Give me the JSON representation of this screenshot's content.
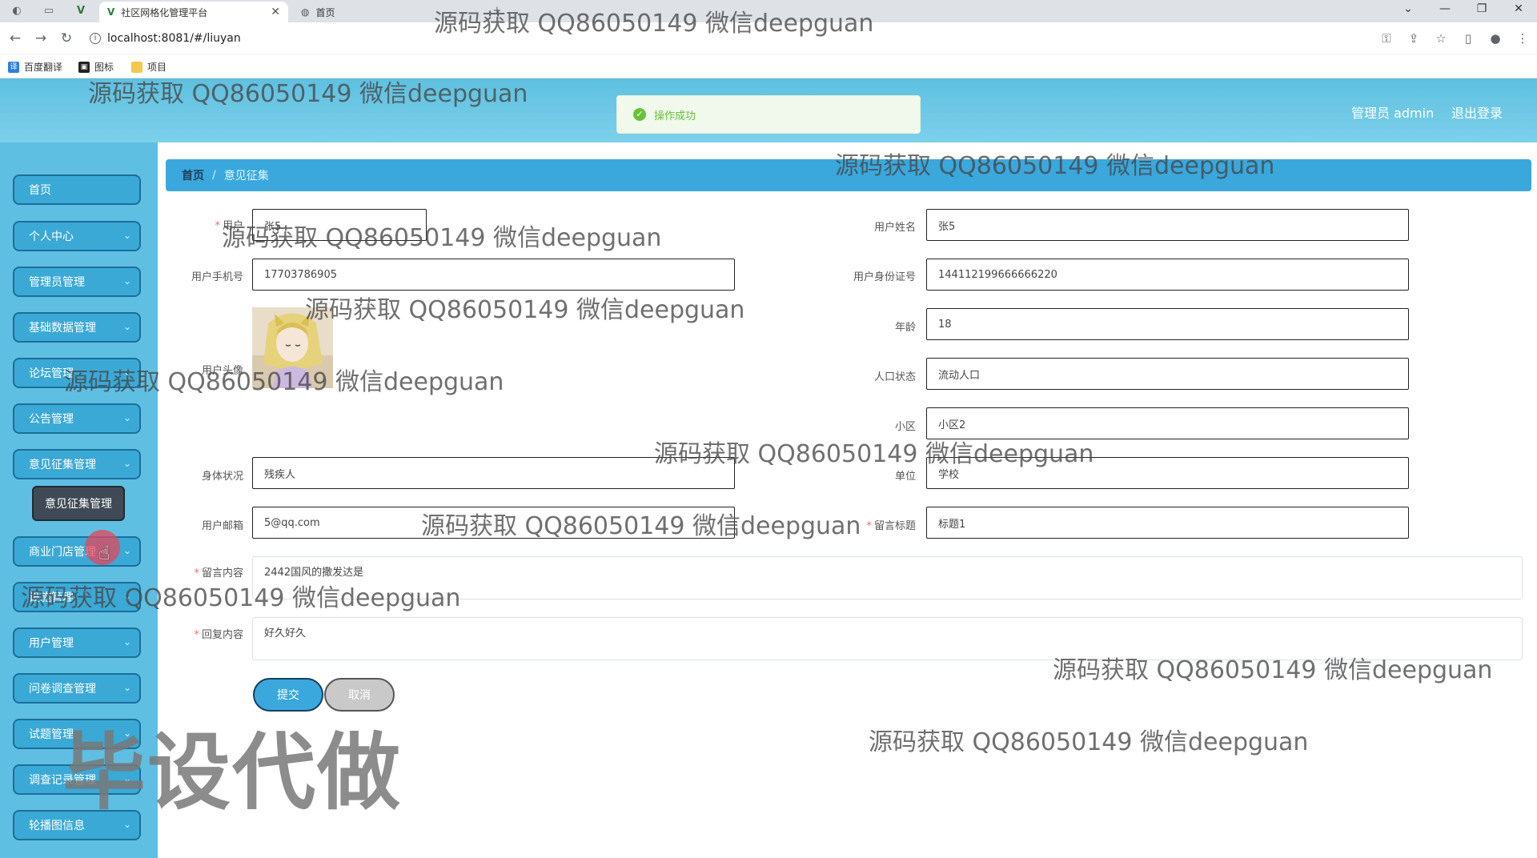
{
  "browser": {
    "tabs": [
      {
        "title": "社区网格化管理平台",
        "active": true
      },
      {
        "title": "首页",
        "active": false
      }
    ],
    "url": "localhost:8081/#/liuyan",
    "bookmarks": [
      "百度翻译",
      "图标",
      "项目"
    ]
  },
  "header": {
    "toast": "操作成功",
    "user": "管理员 admin",
    "logout": "退出登录"
  },
  "sidebar": {
    "items": [
      {
        "label": "首页",
        "chevron": false
      },
      {
        "label": "个人中心",
        "chevron": true
      },
      {
        "label": "管理员管理",
        "chevron": true
      },
      {
        "label": "基础数据管理",
        "chevron": true
      },
      {
        "label": "论坛管理",
        "chevron": true
      },
      {
        "label": "公告管理",
        "chevron": true
      },
      {
        "label": "意见征集管理",
        "chevron": true
      },
      {
        "label": "商业门店管理",
        "chevron": true
      },
      {
        "label": "设施管理",
        "chevron": true
      },
      {
        "label": "用户管理",
        "chevron": true
      },
      {
        "label": "问卷调查管理",
        "chevron": true
      },
      {
        "label": "试题管理",
        "chevron": true
      },
      {
        "label": "调查记录管理",
        "chevron": true
      },
      {
        "label": "轮播图信息",
        "chevron": true
      }
    ],
    "submenu_open": "意见征集管理"
  },
  "breadcrumb": {
    "home": "首页",
    "separator": "/",
    "current": "意见征集"
  },
  "form": {
    "labels": {
      "user": "用户",
      "user_name": "用户姓名",
      "phone": "用户手机号",
      "id_card": "用户身份证号",
      "age": "年龄",
      "avatar": "用户头像",
      "population": "人口状态",
      "community": "小区",
      "health": "身体状况",
      "unit": "单位",
      "email": "用户邮箱",
      "title": "留言标题",
      "content": "留言内容",
      "reply": "回复内容"
    },
    "values": {
      "user": "张5",
      "user_name": "张5",
      "phone": "17703786905",
      "id_card": "144112199666666220",
      "age": "18",
      "population": "流动人口",
      "community": "小区2",
      "health": "残疾人",
      "unit": "学校",
      "email": "5@qq.com",
      "title": "标题1",
      "content": "2442国风的撒发达是",
      "reply": "好久好久"
    },
    "buttons": {
      "submit": "提交",
      "cancel": "取消"
    }
  },
  "watermarks": {
    "text": "源码获取 QQ86050149 微信deepguan",
    "big": "毕设代做"
  },
  "colors": {
    "header": "#6ac8e6",
    "sidebar": "#5fbfe2",
    "menu_item": "#3ba9d6",
    "breadcrumb": "#3aa8dd",
    "success": "#67c23a"
  }
}
